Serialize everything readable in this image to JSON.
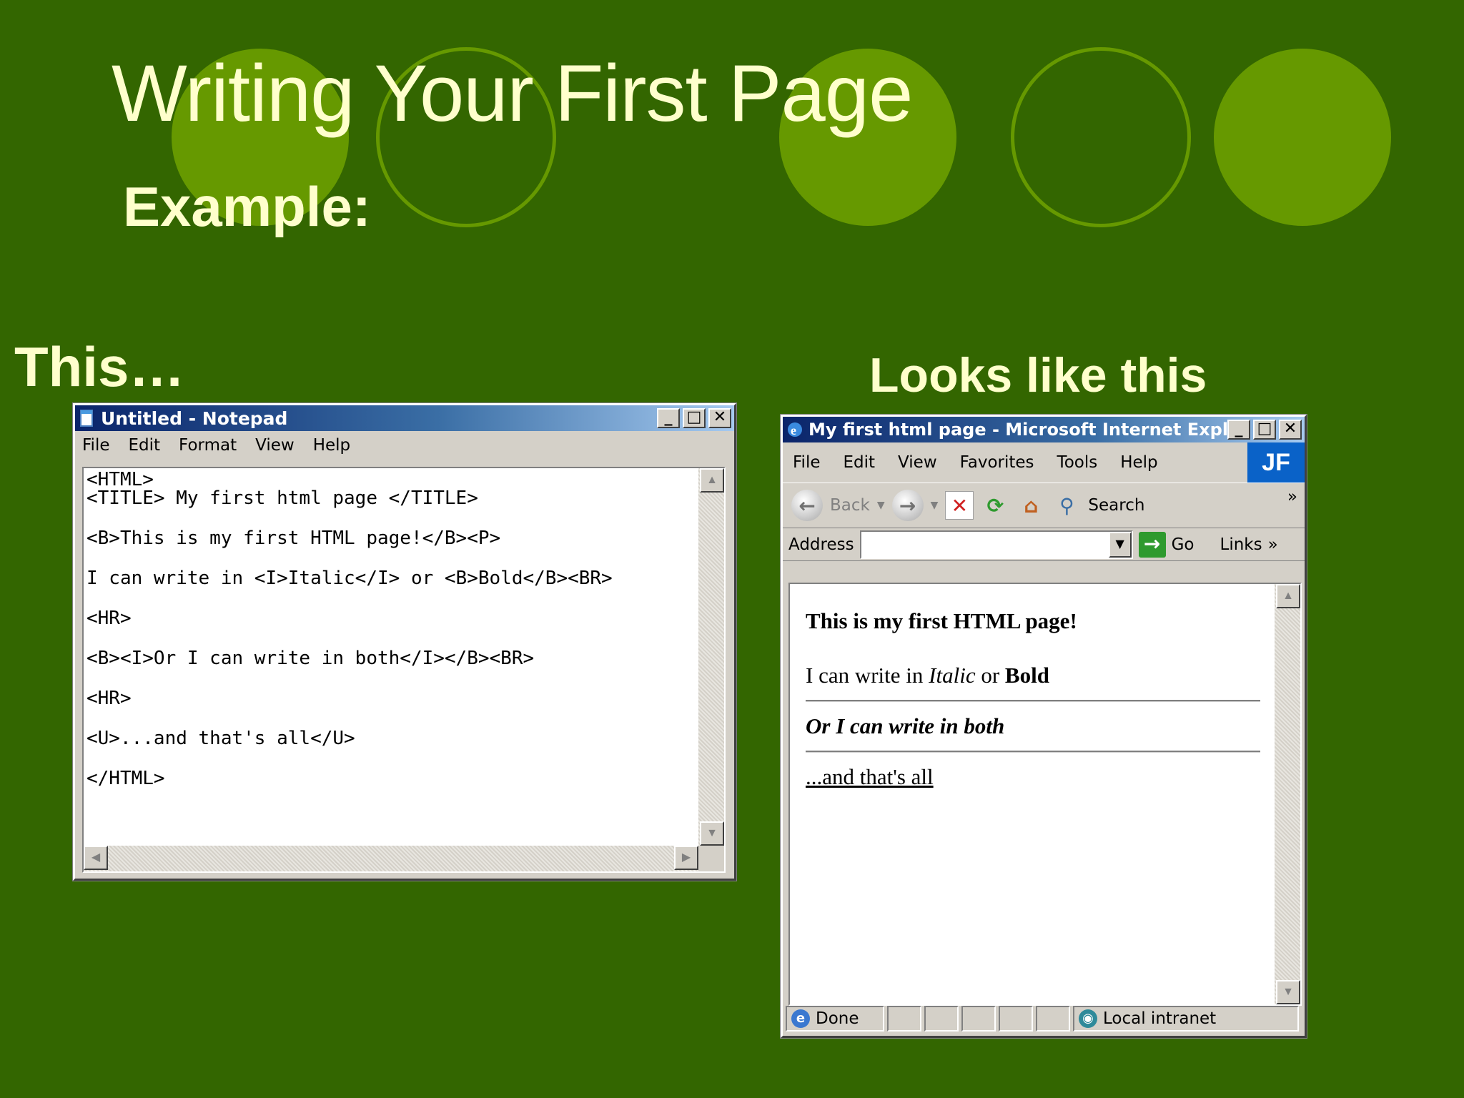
{
  "slide": {
    "title": "Writing Your First Page",
    "subtitle": "Example:",
    "caption_left": "This…",
    "caption_right": "Looks like this"
  },
  "notepad": {
    "title": "Untitled - Notepad",
    "menu": [
      "File",
      "Edit",
      "Format",
      "View",
      "Help"
    ],
    "lines": [
      "<HTML>",
      "<TITLE> My first html page </TITLE>",
      "<B>This is my first HTML page!</B><P>",
      "I can write in <I>Italic</I> or <B>Bold</B><BR>",
      "<HR>",
      "<B><I>Or I can write in both</I></B><BR>",
      "<HR>",
      "<U>...and that's all</U>",
      "</HTML>"
    ]
  },
  "ie": {
    "title": "My first html page - Microsoft Internet Explor...",
    "menu": [
      "File",
      "Edit",
      "View",
      "Favorites",
      "Tools",
      "Help"
    ],
    "logo": "JF",
    "toolbar": {
      "back": "Back",
      "search": "Search",
      "more": "»"
    },
    "address": {
      "label": "Address",
      "value": "",
      "go": "Go",
      "links": "Links",
      "more": "»"
    },
    "content": {
      "heading": "This is my first HTML page!",
      "p_before_italic": "I can write in ",
      "italic": "Italic",
      "p_between": " or ",
      "bold": "Bold",
      "bold_italic": "Or I can write in both",
      "underline": "...and that's all"
    },
    "status": {
      "left": "Done",
      "zone": "Local intranet"
    }
  },
  "colors": {
    "background": "#336600",
    "circle": "#669900",
    "text": "#FFFFCC"
  }
}
